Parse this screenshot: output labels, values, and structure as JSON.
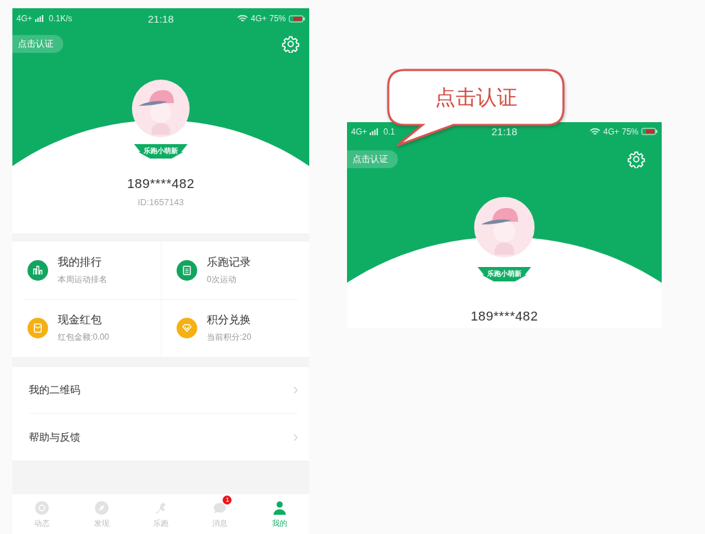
{
  "left_screen": {
    "status_bar": {
      "network": "4G+",
      "net_speed": "0.1K/s",
      "time": "21:18",
      "network_right": "4G+",
      "battery": "75%"
    },
    "verify_button": "点击认证",
    "profile": {
      "badge": "乐跑小萌新",
      "phone": "189****482",
      "user_id": "ID:1657143"
    },
    "features": [
      {
        "kind": "ranking",
        "title": "我的排行",
        "subtitle": "本周运动排名",
        "color": "#12a55f"
      },
      {
        "kind": "record",
        "title": "乐跑记录",
        "subtitle": "0次运动",
        "color": "#12a55f"
      },
      {
        "kind": "red_packet",
        "title": "现金红包",
        "subtitle": "红包金额:0.00",
        "color": "#f5b014"
      },
      {
        "kind": "points",
        "title": "积分兑换",
        "subtitle": "当前积分:20",
        "color": "#f5b014"
      }
    ],
    "menu": [
      {
        "label": "我的二维码"
      },
      {
        "label": "帮助与反馈"
      }
    ],
    "tab_bar": [
      {
        "kind": "feed",
        "label": "动态",
        "selected": false
      },
      {
        "kind": "discover",
        "label": "发现",
        "selected": false
      },
      {
        "kind": "run",
        "label": "乐跑",
        "selected": false
      },
      {
        "kind": "message",
        "label": "消息",
        "selected": false,
        "badge": "1"
      },
      {
        "kind": "me",
        "label": "我的",
        "selected": true
      }
    ]
  },
  "right_screen": {
    "callout": "点击认证",
    "status_bar": {
      "network": "4G+",
      "net_speed": "0.1",
      "time": "21:18",
      "network_right": "4G+",
      "battery": "75%"
    },
    "verify_button": "点击认证",
    "profile": {
      "badge": "乐跑小萌新",
      "phone": "189****482"
    }
  }
}
